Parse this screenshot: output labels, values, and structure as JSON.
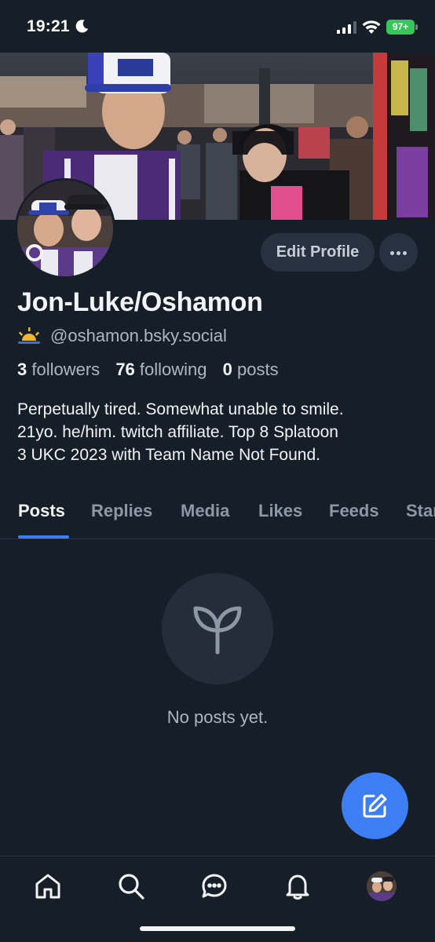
{
  "status_bar": {
    "time": "19:21",
    "battery": "97+",
    "icons": [
      "moon-icon",
      "signal-icon",
      "wifi-icon",
      "battery-icon"
    ]
  },
  "profile": {
    "display_name": "Jon-Luke/Oshamon",
    "handle": "@oshamon.bsky.social",
    "handle_icon": "sunrise-icon",
    "followers_count": "3",
    "followers_label": "followers",
    "following_count": "76",
    "following_label": "following",
    "posts_count": "0",
    "posts_label": "posts",
    "bio_lines": [
      "Perpetually tired. Somewhat unable to smile.",
      "21yo. he/him. twitch affiliate. Top 8 Splatoon",
      "3 UKC 2023 with Team Name Not Found."
    ]
  },
  "actions": {
    "edit_profile": "Edit Profile",
    "more_icon": "ellipsis-icon"
  },
  "tabs": [
    {
      "label": "Posts",
      "active": true
    },
    {
      "label": "Replies",
      "active": false
    },
    {
      "label": "Media",
      "active": false
    },
    {
      "label": "Likes",
      "active": false
    },
    {
      "label": "Feeds",
      "active": false
    },
    {
      "label": "Starter Packs",
      "active": false
    }
  ],
  "empty_state": {
    "icon": "sprout-icon",
    "text": "No posts yet."
  },
  "fab": {
    "icon": "compose-icon"
  },
  "bottom_nav": {
    "items": [
      "home-icon",
      "search-icon",
      "chat-icon",
      "bell-icon",
      "profile-avatar"
    ]
  },
  "colors": {
    "background": "#161e27",
    "accent": "#3d7ef5",
    "muted_text": "#aeb6c1",
    "button_bg": "#28313f"
  }
}
